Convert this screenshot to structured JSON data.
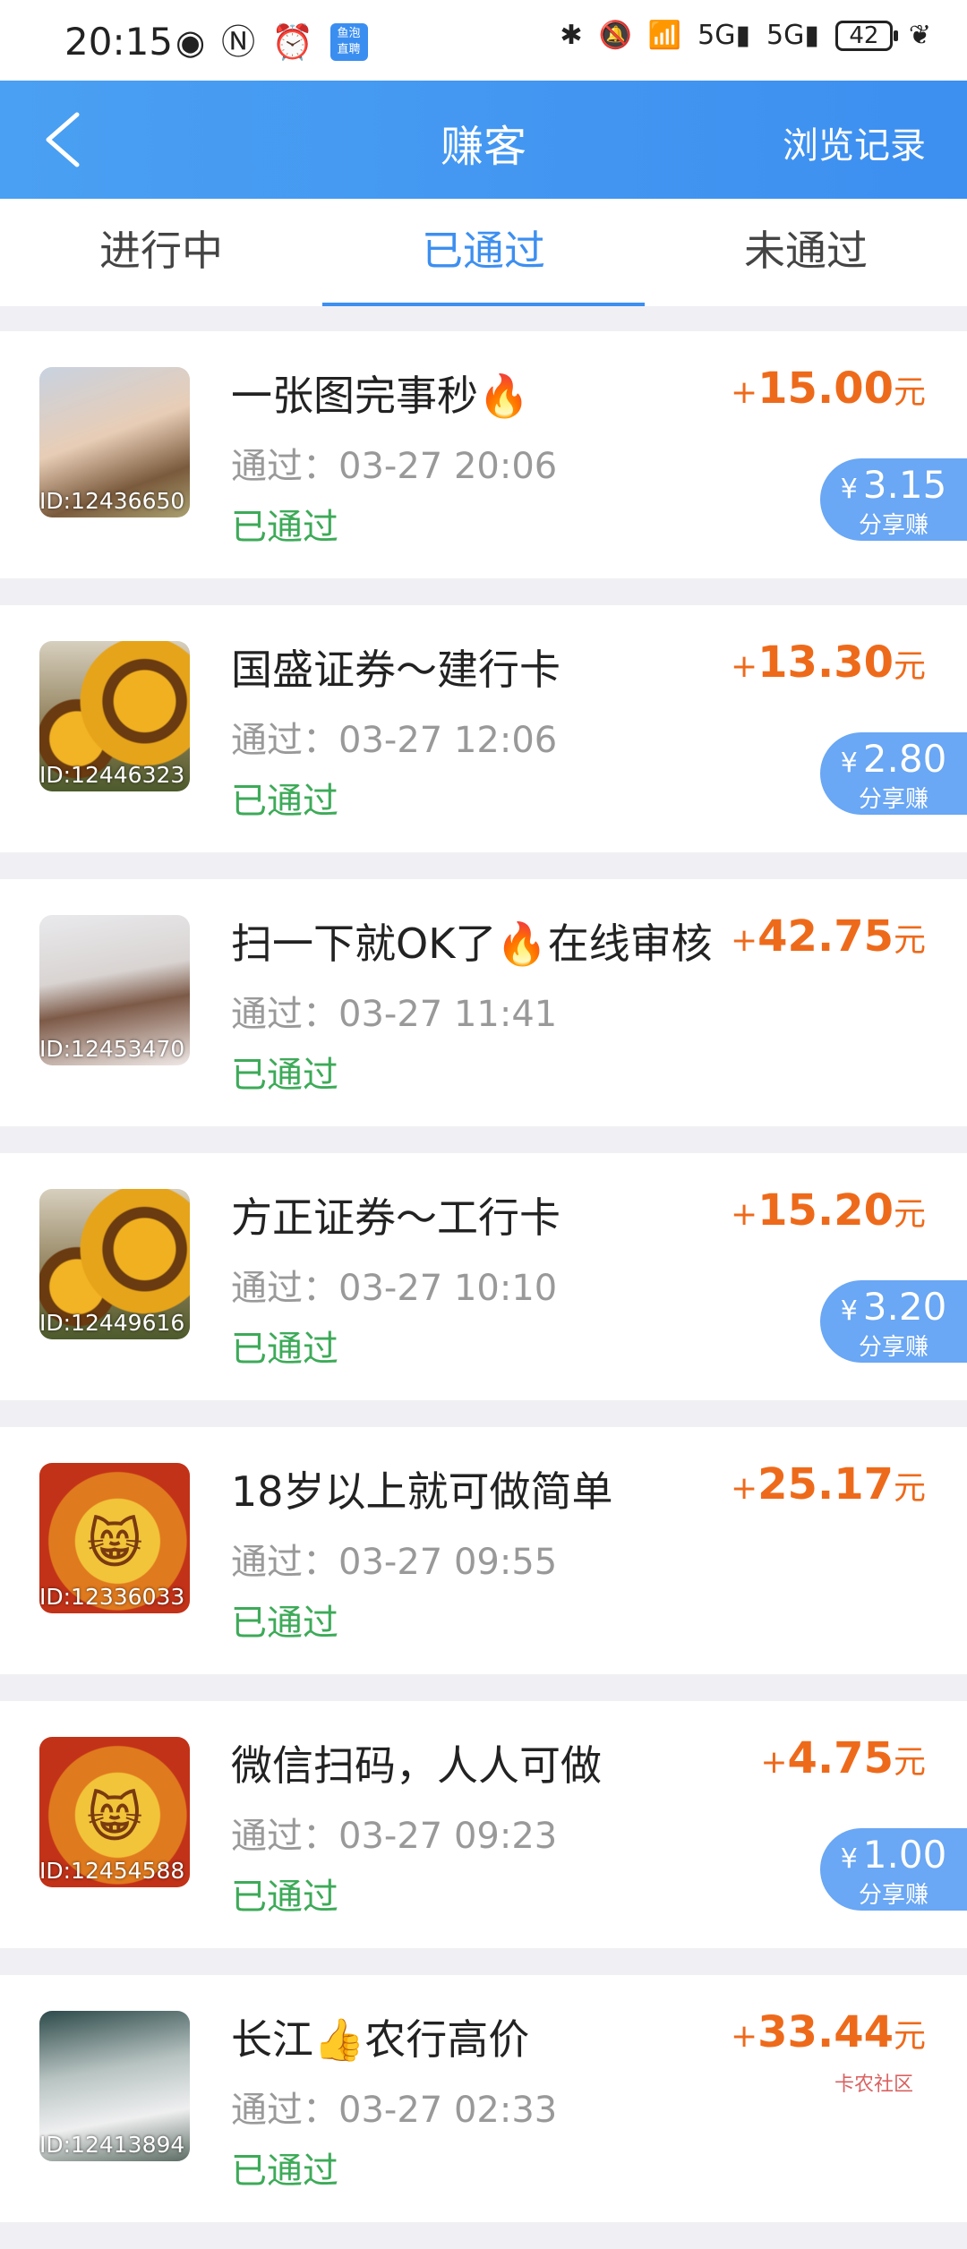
{
  "status_bar": {
    "time": "20:15",
    "battery": "42",
    "app_badge": "鱼泡直聘"
  },
  "header": {
    "title": "赚客",
    "history_label": "浏览记录"
  },
  "tabs": [
    {
      "label": "进行中",
      "active": false
    },
    {
      "label": "已通过",
      "active": true
    },
    {
      "label": "未通过",
      "active": false
    }
  ],
  "items": [
    {
      "title": "一张图完事秒🔥",
      "id": "ID:12436650",
      "passed": "通过：03-27 20:06",
      "status": "已通过",
      "amount": "15.00",
      "unit": "元",
      "share": "3.15",
      "share_label": "分享赚",
      "thumb": "girl"
    },
    {
      "title": "国盛证券～建行卡",
      "id": "ID:12446323",
      "passed": "通过：03-27 12:06",
      "status": "已通过",
      "amount": "13.30",
      "unit": "元",
      "share": "2.80",
      "share_label": "分享赚",
      "thumb": "sunflower"
    },
    {
      "title": "扫一下就OK了🔥在线审核",
      "id": "ID:12453470",
      "passed": "通过：03-27 11:41",
      "status": "已通过",
      "amount": "42.75",
      "unit": "元",
      "share": null,
      "thumb": "girl2"
    },
    {
      "title": "方正证券～工行卡",
      "id": "ID:12449616",
      "passed": "通过：03-27 10:10",
      "status": "已通过",
      "amount": "15.20",
      "unit": "元",
      "share": "3.20",
      "share_label": "分享赚",
      "thumb": "sunflower"
    },
    {
      "title": "18岁以上就可做简单",
      "id": "ID:12336033",
      "passed": "通过：03-27 09:55",
      "status": "已通过",
      "amount": "25.17",
      "unit": "元",
      "share": null,
      "thumb": "lion"
    },
    {
      "title": "微信扫码，人人可做",
      "id": "ID:12454588",
      "passed": "通过：03-27 09:23",
      "status": "已通过",
      "amount": "4.75",
      "unit": "元",
      "share": "1.00",
      "share_label": "分享赚",
      "thumb": "lion"
    },
    {
      "title": "长江👍农行高价",
      "id": "ID:12413894",
      "passed": "通过：03-27 02:33",
      "status": "已通过",
      "amount": "33.44",
      "unit": "元",
      "share": null,
      "thumb": "girl3"
    }
  ],
  "watermark": "卡农社区",
  "colors": {
    "header": "#3d8ff0",
    "amount": "#ee6a1b",
    "status": "#3daa58",
    "badge": "#6aa7f4"
  }
}
